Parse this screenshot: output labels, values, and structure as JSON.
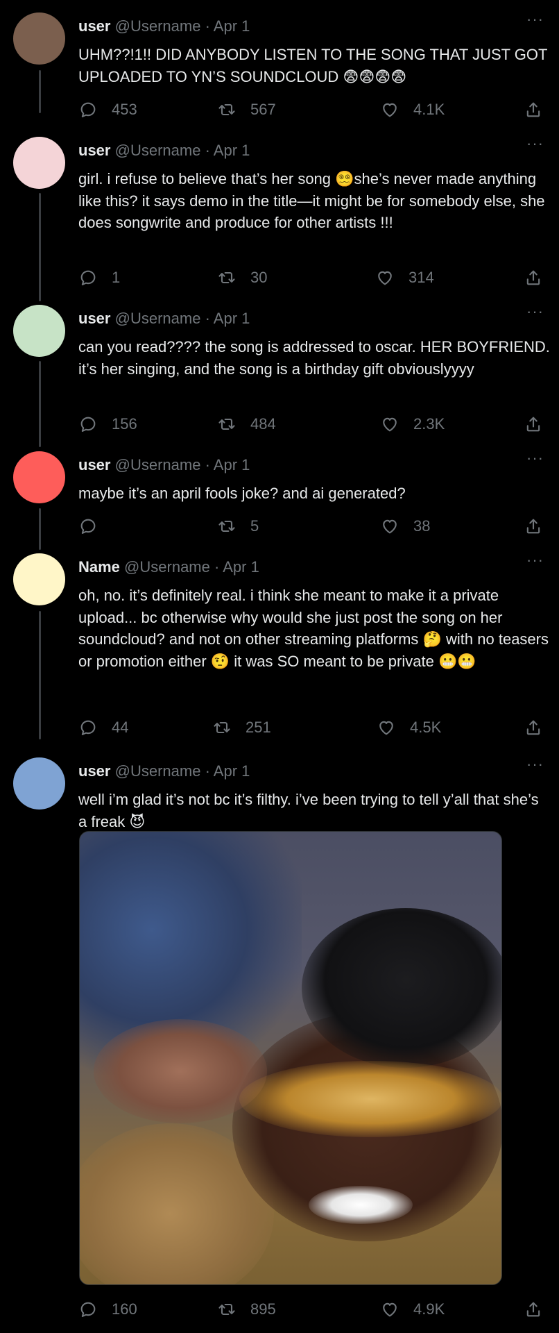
{
  "tweets": [
    {
      "name": "user",
      "handle": "@Username",
      "sep": "·",
      "date": "Apr 1",
      "text": "UHM??!1!! DID ANYBODY LISTEN TO THE SONG THAT JUST GOT UPLOADED TO YN’S SOUNDCLOUD 😨😨😨😨",
      "replies": "453",
      "retweets": "567",
      "likes": "4.1K",
      "avatar_color": "#7b5f4e"
    },
    {
      "name": "user",
      "handle": "@Username",
      "sep": "·",
      "date": "Apr 1",
      "text": "girl. i refuse to believe that’s her song 😵‍💫she’s never made anything like this? it says demo in the title—it might be for somebody else, she does songwrite and produce for other artists !!!",
      "replies": "1",
      "retweets": "30",
      "likes": "314",
      "avatar_color": "#f4d4d7"
    },
    {
      "name": "user",
      "handle": "@Username",
      "sep": "·",
      "date": "Apr 1",
      "text": "can you read???? the song is addressed to oscar. HER BOYFRIEND. it’s her singing, and the song is a birthday gift obviouslyyyy",
      "replies": "156",
      "retweets": "484",
      "likes": "2.3K",
      "avatar_color": "#c7e3c6"
    },
    {
      "name": "user",
      "handle": "@Username",
      "sep": "·",
      "date": "Apr 1",
      "text": "maybe it’s an april fools joke? and ai generated?",
      "replies": "",
      "retweets": "5",
      "likes": "38",
      "avatar_color": "#fe5d5a"
    },
    {
      "name": "Name",
      "handle": "@Username",
      "sep": "·",
      "date": "Apr 1",
      "text": "oh, no. it’s definitely real. i think she meant to make it a private upload... bc otherwise why would she just post the song on her soundcloud? and not on other streaming platforms 🤔 with no teasers or promotion either 🤨 it was SO meant to be private 😬😬",
      "replies": "44",
      "retweets": "251",
      "likes": "4.5K",
      "avatar_color": "#fff6c8"
    },
    {
      "name": "user",
      "handle": "@Username",
      "sep": "·",
      "date": "Apr 1",
      "text": "well i’m glad it’s not bc it’s filthy. i’ve been trying to tell y’all that she’s a freak 😈",
      "replies": "160",
      "retweets": "895",
      "likes": "4.9K",
      "avatar_color": "#7fa3d3",
      "has_media": true
    }
  ],
  "icons": {
    "reply": "reply-icon",
    "retweet": "retweet-icon",
    "like": "heart-icon",
    "share": "share-icon",
    "more": "more-dots-icon"
  },
  "more_glyph": "···"
}
